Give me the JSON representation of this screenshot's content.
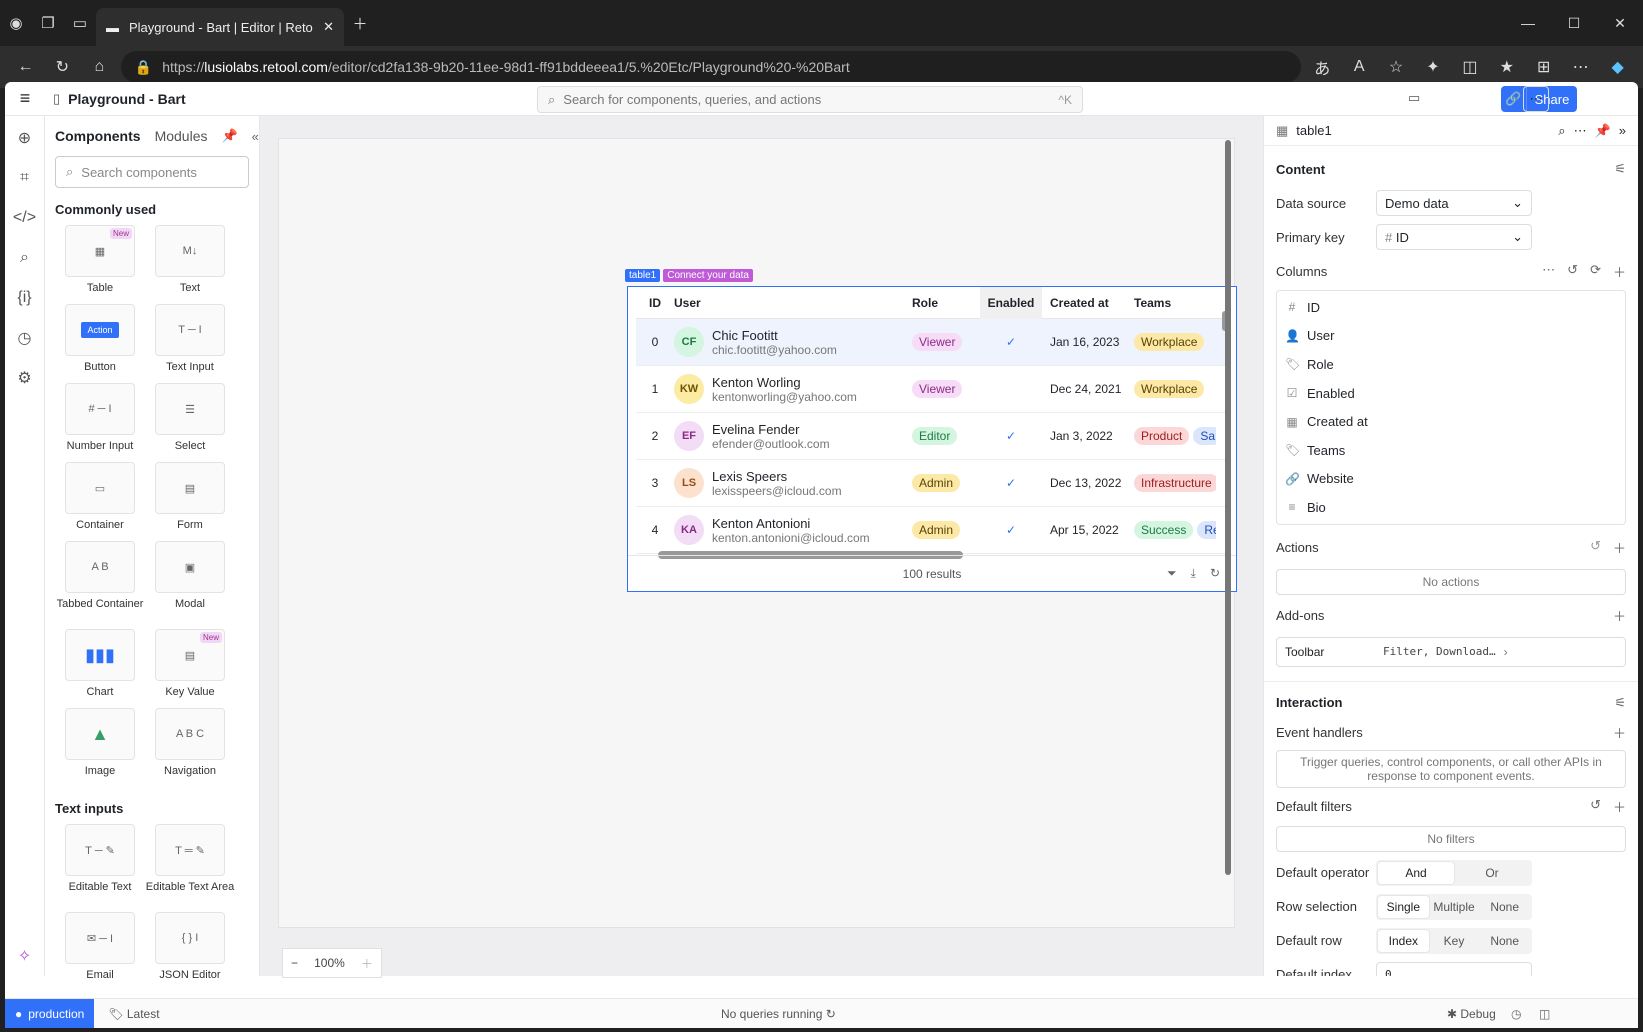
{
  "browser": {
    "tab_title": "Playground - Bart | Editor | Retool",
    "url_scheme": "https://",
    "url_domain": "lusiolabs.retool.com",
    "url_path": "/editor/cd2fa138-9b20-11ee-98d1-ff91bddeeea1/5.%20Etc/Playground%20-%20Bart"
  },
  "header": {
    "page_title": "Playground - Bart",
    "search_placeholder": "Search for components, queries, and actions",
    "search_shortcut": "^K",
    "share_label": "Share"
  },
  "left_panel": {
    "tab_components": "Components",
    "tab_modules": "Modules",
    "search_placeholder": "Search components",
    "section_common": "Commonly used",
    "section_text_inputs": "Text inputs",
    "new_badge": "New",
    "components": [
      {
        "name": "Table"
      },
      {
        "name": "Text"
      },
      {
        "name": "Button"
      },
      {
        "name": "Text Input"
      },
      {
        "name": "Number Input"
      },
      {
        "name": "Select"
      },
      {
        "name": "Container"
      },
      {
        "name": "Form"
      },
      {
        "name": "Tabbed Container"
      },
      {
        "name": "Modal"
      },
      {
        "name": "Chart"
      },
      {
        "name": "Key Value"
      },
      {
        "name": "Image"
      },
      {
        "name": "Navigation"
      }
    ],
    "text_inputs": [
      {
        "name": "Editable Text"
      },
      {
        "name": "Editable Text Area"
      },
      {
        "name": "Email"
      },
      {
        "name": "JSON Editor"
      }
    ],
    "icon_text": {
      "md": "M↓",
      "action": "Action",
      "tabs": "A B",
      "nav": "A B C"
    }
  },
  "table": {
    "label": "table1",
    "connect_label": "Connect your data",
    "headers": {
      "id": "ID",
      "user": "User",
      "role": "Role",
      "enabled": "Enabled",
      "created": "Created at",
      "teams": "Teams"
    },
    "check": "✓",
    "rows": [
      {
        "id": "0",
        "initials": "CF",
        "name": "Chic Footitt",
        "email": "chic.footitt@yahoo.com",
        "role": "Viewer",
        "enabled": true,
        "created": "Jan 16, 2023",
        "team": "Workplace",
        "team2": "",
        "av_bg": "#d4f5df",
        "av_fg": "#1c7a44",
        "role_bg": "#f6dcf6",
        "role_fg": "#8b2b86",
        "team_bg": "#fce9a7",
        "team_fg": "#5a4200"
      },
      {
        "id": "1",
        "initials": "KW",
        "name": "Kenton Worling",
        "email": "kentonworling@yahoo.com",
        "role": "Viewer",
        "enabled": false,
        "created": "Dec 24, 2021",
        "team": "Workplace",
        "team2": "",
        "av_bg": "#fbeba3",
        "av_fg": "#6e5300",
        "role_bg": "#f6dcf6",
        "role_fg": "#8b2b86",
        "team_bg": "#fce9a7",
        "team_fg": "#5a4200"
      },
      {
        "id": "2",
        "initials": "EF",
        "name": "Evelina Fender",
        "email": "efender@outlook.com",
        "role": "Editor",
        "enabled": true,
        "created": "Jan 3, 2022",
        "team": "Product",
        "team2": "Sa",
        "av_bg": "#f3dcf6",
        "av_fg": "#8b2b86",
        "role_bg": "#d4f5df",
        "role_fg": "#1c7a44",
        "team_bg": "#fcd7d7",
        "team_fg": "#9b1c1c"
      },
      {
        "id": "3",
        "initials": "LS",
        "name": "Lexis Speers",
        "email": "lexisspeers@icloud.com",
        "role": "Admin",
        "enabled": true,
        "created": "Dec 13, 2022",
        "team": "Infrastructure",
        "team2": "",
        "av_bg": "#fde1cf",
        "av_fg": "#9b4a12",
        "role_bg": "#fce9a7",
        "role_fg": "#5a4200",
        "team_bg": "#fcd7d7",
        "team_fg": "#9b1c1c"
      },
      {
        "id": "4",
        "initials": "KA",
        "name": "Kenton Antonioni",
        "email": "kenton.antonioni@icloud.com",
        "role": "Admin",
        "enabled": true,
        "created": "Apr 15, 2022",
        "team": "Success",
        "team2": "Re",
        "av_bg": "#f3dcf6",
        "av_fg": "#8b2b86",
        "role_bg": "#fce9a7",
        "role_fg": "#5a4200",
        "team_bg": "#d4f5df",
        "team_fg": "#1c7a44"
      }
    ],
    "results": "100 results"
  },
  "zoom": {
    "value": "100%"
  },
  "inspector": {
    "component": "table1",
    "content": "Content",
    "data_source_label": "Data source",
    "data_source_value": "Demo data",
    "primary_key_label": "Primary key",
    "primary_key_value": "ID",
    "columns_label": "Columns",
    "columns": [
      {
        "icon": "#",
        "name": "ID"
      },
      {
        "icon": "👤",
        "name": "User"
      },
      {
        "icon": "🏷",
        "name": "Role"
      },
      {
        "icon": "☑",
        "name": "Enabled"
      },
      {
        "icon": "▦",
        "name": "Created at"
      },
      {
        "icon": "🏷",
        "name": "Teams"
      },
      {
        "icon": "🔗",
        "name": "Website"
      },
      {
        "icon": "≡",
        "name": "Bio"
      }
    ],
    "actions_label": "Actions",
    "no_actions": "No actions",
    "addons_label": "Add-ons",
    "toolbar_label": "Toolbar",
    "toolbar_value": "Filter, Download…",
    "interaction": "Interaction",
    "event_handlers": "Event handlers",
    "event_hint": "Trigger queries, control components, or call other APIs in response to component events.",
    "default_filters": "Default filters",
    "no_filters": "No filters",
    "default_operator": "Default operator",
    "op_and": "And",
    "op_or": "Or",
    "row_selection": "Row selection",
    "rs_single": "Single",
    "rs_multiple": "Multiple",
    "rs_none": "None",
    "default_row": "Default row",
    "dr_index": "Index",
    "dr_key": "Key",
    "dr_none": "None",
    "default_index": "Default index",
    "default_index_value": "0"
  },
  "status": {
    "env": "production",
    "version": "Latest",
    "queries": "No queries running",
    "debug": "Debug"
  },
  "colors": {
    "accent": "#3170f9",
    "connect": "#c05ad6"
  }
}
